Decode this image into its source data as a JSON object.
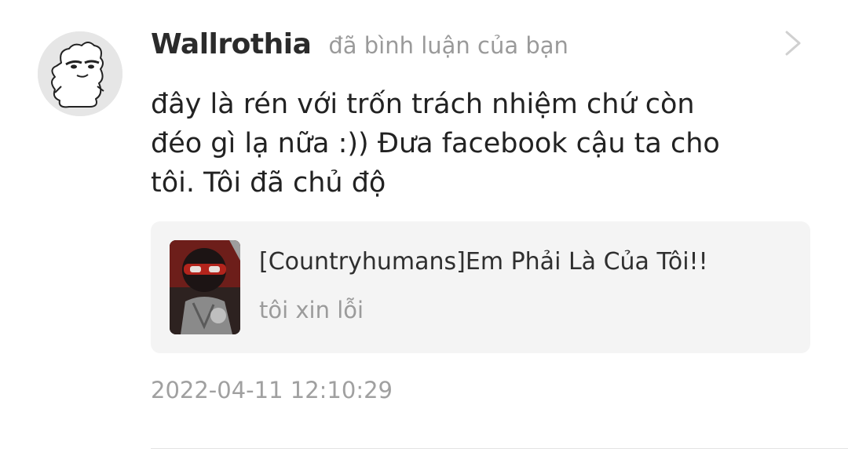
{
  "notification": {
    "username": "Wallrothia",
    "action": "đã bình luận của bạn",
    "comment_lines": [
      "đây là rén với trốn trách nhiệm chứ còn",
      "đéo gì lạ nữa :)) Đưa facebook cậu ta cho",
      "tôi. Tôi đã chủ độ"
    ],
    "story": {
      "title": "[Countryhumans]Em Phải Là Của Tôi!!",
      "subtitle": "tôi xin lỗi"
    },
    "timestamp": "2022-04-11 12:10:29"
  },
  "icons": {
    "avatar": "sketch-creature-avatar",
    "chevron": "chevron-right-icon",
    "cover": "story-cover-thumbnail"
  },
  "colors": {
    "background": "#ffffff",
    "username": "#2b2b2b",
    "muted": "#9a9a9a",
    "card": "#f4f4f4"
  }
}
